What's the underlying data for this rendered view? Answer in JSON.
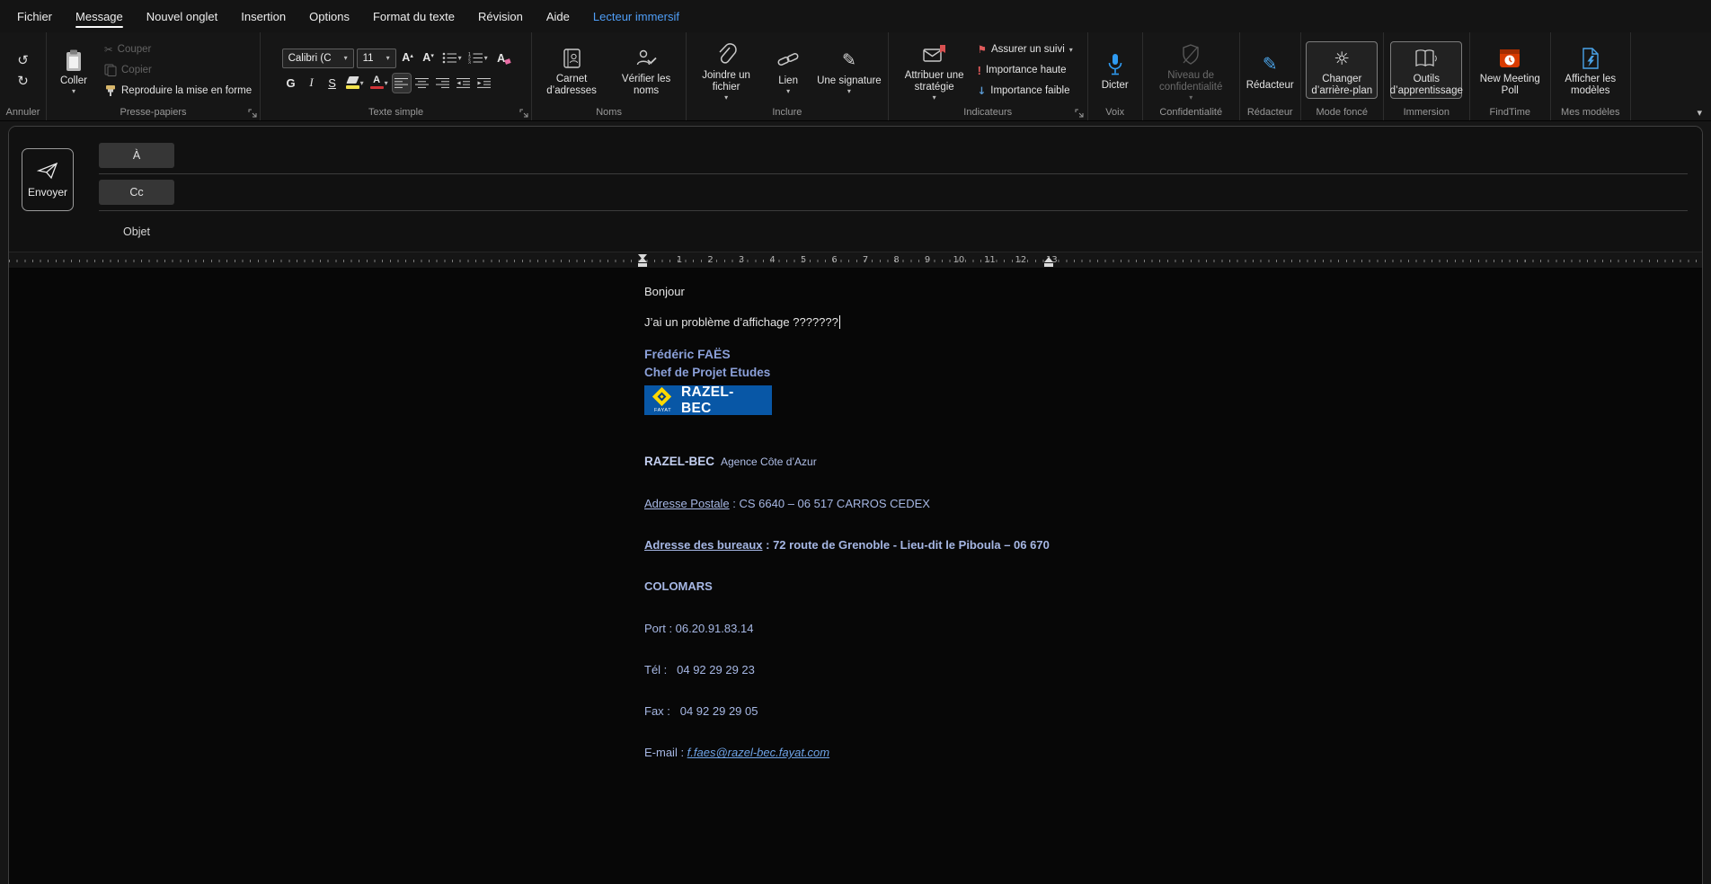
{
  "menubar": {
    "items": [
      "Fichier",
      "Message",
      "Nouvel onglet",
      "Insertion",
      "Options",
      "Format du texte",
      "Révision",
      "Aide",
      "Lecteur immersif"
    ]
  },
  "icons": {
    "undo": "↺",
    "redo": "↻",
    "caret": "▾",
    "scissors": "✂",
    "flag": "⚑",
    "importance_high": "!",
    "importance_low": "↓",
    "sun": "☼",
    "editor_pen": "✎",
    "signature_pen": "✎",
    "grow_letter": "A",
    "grow_arrow": "▴",
    "shrink_letter": "A",
    "shrink_arrow": "▾",
    "clear_letter": "A",
    "font_color_letter": "A",
    "collapse": "▾"
  },
  "ribbon": {
    "annuler": {
      "label": "Annuler"
    },
    "presse_papiers": {
      "label": "Presse-papiers",
      "coller": "Coller",
      "couper": "Couper",
      "copier": "Copier",
      "reproduire": "Reproduire la mise en forme"
    },
    "texte_simple": {
      "label": "Texte simple",
      "font": "Calibri (C",
      "size": "11",
      "bold": "G",
      "italic": "I",
      "underline": "S"
    },
    "noms": {
      "label": "Noms",
      "carnet": "Carnet d’adresses",
      "verifier": "Vérifier les noms"
    },
    "inclure": {
      "label": "Inclure",
      "joindre": "Joindre un fichier",
      "lien": "Lien",
      "signature": "Une signature"
    },
    "indicateurs": {
      "label": "Indicateurs",
      "strategie": "Attribuer une stratégie",
      "suivi": "Assurer un suivi",
      "haute": "Importance haute",
      "faible": "Importance faible"
    },
    "voix": {
      "label": "Voix",
      "dicter": "Dicter"
    },
    "confidentialite": {
      "label": "Confidentialité",
      "niveau": "Niveau de confidentialité"
    },
    "redacteur": {
      "label": "Rédacteur",
      "bouton": "Rédacteur"
    },
    "mode_fonce": {
      "label": "Mode foncé",
      "changer": "Changer d’arrière-plan"
    },
    "immersion": {
      "label": "Immersion",
      "outils": "Outils d’apprentissage"
    },
    "findtime": {
      "label": "FindTime",
      "poll": "New Meeting Poll"
    },
    "modeles": {
      "label": "Mes modèles",
      "afficher": "Afficher les modèles"
    }
  },
  "compose": {
    "send": "Envoyer",
    "to": "À",
    "cc": "Cc",
    "subject": "Objet"
  },
  "ruler": {
    "numbers": [
      "1",
      "2",
      "3",
      "4",
      "5",
      "6",
      "7",
      "8",
      "9",
      "10",
      "11",
      "12",
      "13"
    ]
  },
  "body": {
    "greeting": "Bonjour",
    "message_line": "J’ai un problème d’affichage ???????",
    "signature": {
      "name": "Frédéric FAËS",
      "title": "Chef de Projet Etudes",
      "logo_text": "RAZEL-BEC",
      "logo_sub": "FAYAT",
      "company": "RAZEL-BEC",
      "agency": "Agence Côte d’Azur",
      "postal_label": "Adresse Postale",
      "postal_rest": " : CS 6640 – 06 517 CARROS CEDEX",
      "office_label": "Adresse des bureaux",
      "office_rest": " : 72 route de Grenoble - Lieu-dit le Piboula – 06 670",
      "city": "COLOMARS",
      "port": "Port : 06.20.91.83.14",
      "tel": "Tél :   04 92 29 29 23",
      "fax": "Fax :   04 92 29 29 05",
      "email_label": "E-mail : ",
      "email": "f.faes@razel-bec.fayat.com"
    }
  }
}
